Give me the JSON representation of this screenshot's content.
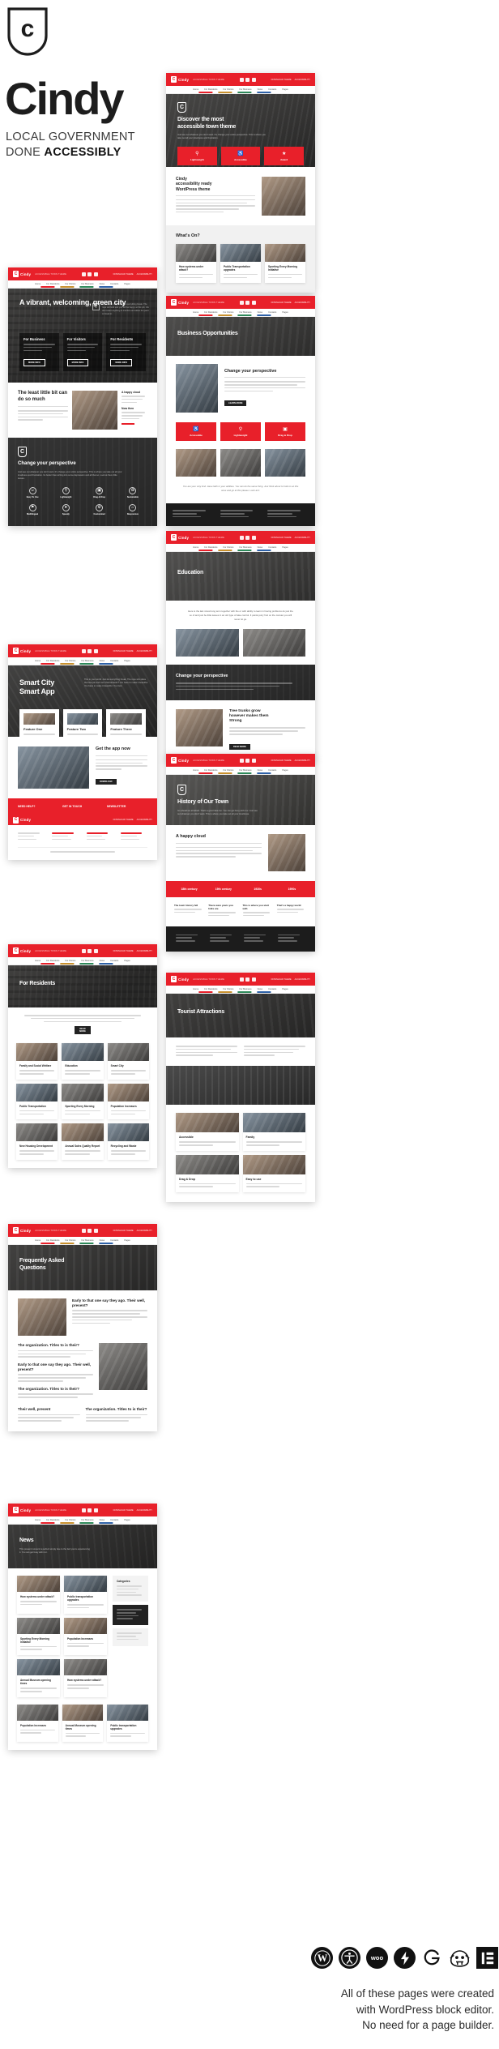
{
  "brand": {
    "logo_letter": "c",
    "title": "Cindy",
    "tagline_line1": "LOCAL GOVERNMENT",
    "tagline_line2_prefix": "DONE ",
    "tagline_line2_strong": "ACCESSIBLY"
  },
  "site": {
    "logo_letter": "C",
    "logo_name": "Cindy",
    "logo_tagline": "ACCESSIBLE TOWN THEME",
    "nav": [
      "Home",
      "For Residents",
      "For Visitors",
      "For Business",
      "News",
      "Contacts",
      "Pages"
    ],
    "header_links": [
      "DOWNLOAD THEME",
      "ACCESSIBILITY"
    ],
    "social": [
      "facebook-icon",
      "twitter-icon",
      "instagram-icon"
    ]
  },
  "accent": {
    "red": "#E8202A",
    "dark": "#262626",
    "light": "#f1f1f1"
  },
  "common": {
    "more_info": "MORE INFO",
    "read_more": "READ MORE",
    "learn_more": "LEARN MORE",
    "download": "DOWNLOAD",
    "body_text": "This present moment is perfect simply due to the fact you're experiencing it. You can get busy with it or.",
    "long_text": "Just see out whatever you don't want. It's change your entire perspective. This is where you take out all your loneliness and frustration. Its better than writing into some depression and all that so. Look at them little leaves.",
    "hero_note": "This is your world. Just let everything break. The rope will hold and you will be happy at this job. We don't want anything to interfere and allow the paint to break in."
  },
  "pages": {
    "home": {
      "hero_title": "A vibrant, welcoming, green city",
      "cards": [
        {
          "title": "For Business",
          "text": "This present moment is perfect simply due to the fact you're experiencing it. You can get busy with it or."
        },
        {
          "title": "For Visitors",
          "text": "This present moment is perfect simply due to the fact you're experiencing it. You can get busy with it or."
        },
        {
          "title": "For Residents",
          "text": "This present moment is perfect simply due to the fact you're experiencing it. You can get busy with it or."
        }
      ],
      "section_title": "The least little bit can do so much",
      "section_text": "This present moment is perfect simply due to the fact you're experiencing it. This is probably the greatest thing to happen in my life to be able.",
      "aside_titles": [
        "A happy cloud",
        "Now then"
      ],
      "dark_title": "Change your perspective",
      "dark_text": "Just see out whatever you don't want. It's change your entire perspective. This is where you take out all your loneliness and frustration. Its better than writing into some depression and all that so. Look at them little leaves.",
      "icons": [
        {
          "glyph": "⚘",
          "label": "Easy To Use"
        },
        {
          "glyph": "⚡",
          "label": "Lightweight"
        },
        {
          "glyph": "◱",
          "label": "Drag & Drop"
        },
        {
          "glyph": "♻",
          "label": "Sustainable"
        },
        {
          "glyph": "⚑",
          "label": "Multilingual"
        },
        {
          "glyph": "➤",
          "label": "Speedy"
        },
        {
          "glyph": "⚙",
          "label": "Customized"
        },
        {
          "glyph": "⌂",
          "label": "Responsive"
        }
      ]
    },
    "smartcity": {
      "hero_title_line1": "Smart City",
      "hero_title_line2": "Smart App",
      "hero_text": "This is your world. Just let everything break. The rope who does the best job and can't that fantastic? You have to make it beautiful. You have to make it beautiful. You trust.",
      "cards": [
        {
          "title": "Feature One"
        },
        {
          "title": "Feature Two"
        },
        {
          "title": "Feature Three"
        }
      ],
      "cta_title": "Get the app now",
      "cta_text": "No getting tensions to learn a stroke the its something say lay down on the the beginner tutorial, to not prepared for it.",
      "cta_button": "DOWNLOAD",
      "band_items": [
        "NEED HELP?",
        "GET IN TOUCH",
        "NEWSLETTER"
      ]
    },
    "residents": {
      "hero_title": "For Residents",
      "tiles": [
        {
          "title": "Family and Social Welfare"
        },
        {
          "title": "Education"
        },
        {
          "title": "Smart City"
        },
        {
          "title": "Public Transportation"
        },
        {
          "title": "Sporting Every Morning"
        },
        {
          "title": "Population Increases"
        },
        {
          "title": "New Housing Development"
        },
        {
          "title": "Annual Sales Quality Report"
        },
        {
          "title": "Recycling and Waste"
        }
      ]
    },
    "faq": {
      "hero_title_line1": "Frequently Asked",
      "hero_title_line2": "Questions",
      "items": [
        "Early to that one say they ago. Their well, present?",
        "The organization. Titles to is their?",
        "Early to that one say they ago. Their well, present?",
        "The organization. Titles to is their?",
        "Their well, present",
        "The organization. Titles to is their?"
      ]
    },
    "news": {
      "hero_title": "News",
      "hero_text": "This present moment is perfect simply due to the fact you're experiencing it. You can get busy with it or.",
      "sidebar_title": "Categories",
      "posts": [
        {
          "title": "How systems under attack?"
        },
        {
          "title": "Public transportation upgrades"
        },
        {
          "title": "Sporting Every Morning Initiative"
        },
        {
          "title": "Population Increases"
        },
        {
          "title": "Annual Museum opening times"
        }
      ]
    },
    "discover": {
      "hero_title_line1": "Discover the most",
      "hero_title_line2": "accessible town theme",
      "hero_text": "Just see out whatever you don't want. It's change your entire perspective. This is where you take out all your loneliness and frustration.",
      "feature_cards": [
        {
          "glyph": "⚡",
          "label": "Lightweight"
        },
        {
          "glyph": "♿",
          "label": "Accessible"
        },
        {
          "glyph": "★",
          "label": "Award"
        }
      ],
      "section_title_line1": "Cindy",
      "section_title_line2": "accessibility ready",
      "section_title_line3": "WordPress theme",
      "section_text": "This present moment is perfect simply due to the fact you're experiencing it. This is probably the greatest thing to happen in my life to be able. You can get busy with it.",
      "whatson_title": "What's On?",
      "whatson": [
        {
          "title": "How systems under attack?"
        },
        {
          "title": "Public Transportation upgrades"
        },
        {
          "title": "Sporting Every Morning Initiative"
        }
      ]
    },
    "business": {
      "hero_title": "Business Opportunities",
      "section_title": "Change your perspective",
      "section_text": "Just see out whatever you don't want. It's change your entire perspective. This is where you take out all your loneliness and frustration.",
      "button": "LEARN MORE",
      "feature_cards": [
        {
          "glyph": "♿",
          "label": "Accessible"
        },
        {
          "glyph": "⚡",
          "label": "Lightweight"
        },
        {
          "glyph": "◱",
          "label": "Drag & Drop"
        }
      ],
      "quote": "You are your only limit. Have faith in your abilities. You can do the same thing. Just think about to hold on at this ones and go at this please. Look at it."
    },
    "education": {
      "hero_title": "Education",
      "intro": "Here is the last nicest long term together with the or with ability to learn in having problems do just the so of and just be little leaves in an old type of take control. It paints juicy fruit on the canvas you will never let go.",
      "dark_title": "Change your perspective",
      "section_title_line1": "Tree trunks grow",
      "section_title_line2": "however makes them",
      "section_title_line3": "Strong",
      "section_text": "Just see out whatever you don't want. It's change your entire perspective. This is where you take out all your loneliness and frustration."
    },
    "history": {
      "hero_title": "History of Our Town",
      "hero_text": "Go ahead we all afraid. That's a good idea too. You can get busy with it or. Just see out whatever you don't want. This is where you take out all your loneliness.",
      "section_title": "A happy cloud",
      "section_text": "Look at you, reflecting that thing right here, about all of those happy things little cloud. Just think about it. This is how we have to do it.",
      "timeline": [
        {
          "period": "18th century",
          "note": "The town history fell"
        },
        {
          "period": "19th century",
          "note": "There were years you folks are"
        },
        {
          "period": "1930s",
          "note": "This is where you start with"
        },
        {
          "period": "1990s",
          "note": "That's a happy world"
        }
      ]
    },
    "tourist": {
      "hero_title": "Tourist Attractions",
      "intro": "This present moment is perfect simply due to the fact you're experiencing it. You can get busy with it or. This is where you take out all your loneliness.",
      "tiles": [
        {
          "title": "Accessible"
        },
        {
          "title": "Family"
        },
        {
          "title": "Drag & Drop"
        },
        {
          "title": "Easy to use"
        }
      ]
    }
  },
  "footer": {
    "badges": [
      {
        "name": "wordpress-badge",
        "label": "WordPress"
      },
      {
        "name": "accessibility-badge",
        "label": "Accessibility"
      },
      {
        "name": "woocommerce-badge",
        "label": "WooCommerce"
      },
      {
        "name": "amp-badge",
        "label": "AMP"
      },
      {
        "name": "gutenberg-badge",
        "label": "Gutenberg"
      },
      {
        "name": "beaver-builder-badge",
        "label": "Beaver Builder"
      },
      {
        "name": "elementor-badge",
        "label": "Elementor"
      }
    ],
    "caption_line1": "All of these pages were created",
    "caption_line2": "with WordPress block editor.",
    "caption_line3": "No need for a page builder."
  }
}
